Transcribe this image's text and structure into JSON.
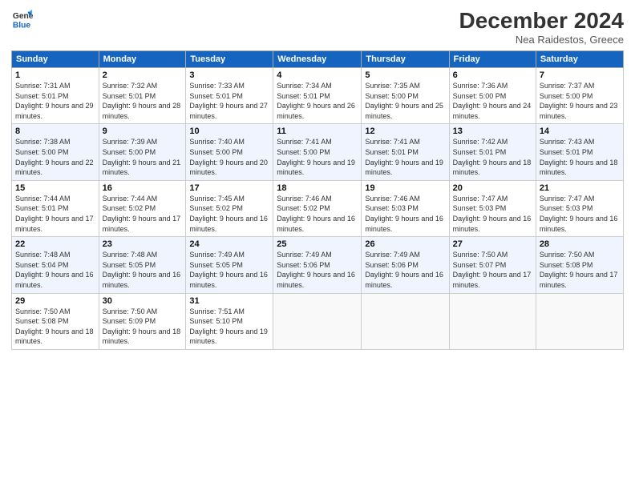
{
  "logo": {
    "line1": "General",
    "line2": "Blue"
  },
  "header": {
    "title": "December 2024",
    "subtitle": "Nea Raidestos, Greece"
  },
  "days_of_week": [
    "Sunday",
    "Monday",
    "Tuesday",
    "Wednesday",
    "Thursday",
    "Friday",
    "Saturday"
  ],
  "weeks": [
    [
      {
        "day": "1",
        "sunrise": "7:31 AM",
        "sunset": "5:01 PM",
        "daylight": "9 hours and 29 minutes."
      },
      {
        "day": "2",
        "sunrise": "7:32 AM",
        "sunset": "5:01 PM",
        "daylight": "9 hours and 28 minutes."
      },
      {
        "day": "3",
        "sunrise": "7:33 AM",
        "sunset": "5:01 PM",
        "daylight": "9 hours and 27 minutes."
      },
      {
        "day": "4",
        "sunrise": "7:34 AM",
        "sunset": "5:01 PM",
        "daylight": "9 hours and 26 minutes."
      },
      {
        "day": "5",
        "sunrise": "7:35 AM",
        "sunset": "5:00 PM",
        "daylight": "9 hours and 25 minutes."
      },
      {
        "day": "6",
        "sunrise": "7:36 AM",
        "sunset": "5:00 PM",
        "daylight": "9 hours and 24 minutes."
      },
      {
        "day": "7",
        "sunrise": "7:37 AM",
        "sunset": "5:00 PM",
        "daylight": "9 hours and 23 minutes."
      }
    ],
    [
      {
        "day": "8",
        "sunrise": "7:38 AM",
        "sunset": "5:00 PM",
        "daylight": "9 hours and 22 minutes."
      },
      {
        "day": "9",
        "sunrise": "7:39 AM",
        "sunset": "5:00 PM",
        "daylight": "9 hours and 21 minutes."
      },
      {
        "day": "10",
        "sunrise": "7:40 AM",
        "sunset": "5:00 PM",
        "daylight": "9 hours and 20 minutes."
      },
      {
        "day": "11",
        "sunrise": "7:41 AM",
        "sunset": "5:00 PM",
        "daylight": "9 hours and 19 minutes."
      },
      {
        "day": "12",
        "sunrise": "7:41 AM",
        "sunset": "5:01 PM",
        "daylight": "9 hours and 19 minutes."
      },
      {
        "day": "13",
        "sunrise": "7:42 AM",
        "sunset": "5:01 PM",
        "daylight": "9 hours and 18 minutes."
      },
      {
        "day": "14",
        "sunrise": "7:43 AM",
        "sunset": "5:01 PM",
        "daylight": "9 hours and 18 minutes."
      }
    ],
    [
      {
        "day": "15",
        "sunrise": "7:44 AM",
        "sunset": "5:01 PM",
        "daylight": "9 hours and 17 minutes."
      },
      {
        "day": "16",
        "sunrise": "7:44 AM",
        "sunset": "5:02 PM",
        "daylight": "9 hours and 17 minutes."
      },
      {
        "day": "17",
        "sunrise": "7:45 AM",
        "sunset": "5:02 PM",
        "daylight": "9 hours and 16 minutes."
      },
      {
        "day": "18",
        "sunrise": "7:46 AM",
        "sunset": "5:02 PM",
        "daylight": "9 hours and 16 minutes."
      },
      {
        "day": "19",
        "sunrise": "7:46 AM",
        "sunset": "5:03 PM",
        "daylight": "9 hours and 16 minutes."
      },
      {
        "day": "20",
        "sunrise": "7:47 AM",
        "sunset": "5:03 PM",
        "daylight": "9 hours and 16 minutes."
      },
      {
        "day": "21",
        "sunrise": "7:47 AM",
        "sunset": "5:03 PM",
        "daylight": "9 hours and 16 minutes."
      }
    ],
    [
      {
        "day": "22",
        "sunrise": "7:48 AM",
        "sunset": "5:04 PM",
        "daylight": "9 hours and 16 minutes."
      },
      {
        "day": "23",
        "sunrise": "7:48 AM",
        "sunset": "5:05 PM",
        "daylight": "9 hours and 16 minutes."
      },
      {
        "day": "24",
        "sunrise": "7:49 AM",
        "sunset": "5:05 PM",
        "daylight": "9 hours and 16 minutes."
      },
      {
        "day": "25",
        "sunrise": "7:49 AM",
        "sunset": "5:06 PM",
        "daylight": "9 hours and 16 minutes."
      },
      {
        "day": "26",
        "sunrise": "7:49 AM",
        "sunset": "5:06 PM",
        "daylight": "9 hours and 16 minutes."
      },
      {
        "day": "27",
        "sunrise": "7:50 AM",
        "sunset": "5:07 PM",
        "daylight": "9 hours and 17 minutes."
      },
      {
        "day": "28",
        "sunrise": "7:50 AM",
        "sunset": "5:08 PM",
        "daylight": "9 hours and 17 minutes."
      }
    ],
    [
      {
        "day": "29",
        "sunrise": "7:50 AM",
        "sunset": "5:08 PM",
        "daylight": "9 hours and 18 minutes."
      },
      {
        "day": "30",
        "sunrise": "7:50 AM",
        "sunset": "5:09 PM",
        "daylight": "9 hours and 18 minutes."
      },
      {
        "day": "31",
        "sunrise": "7:51 AM",
        "sunset": "5:10 PM",
        "daylight": "9 hours and 19 minutes."
      },
      null,
      null,
      null,
      null
    ]
  ]
}
